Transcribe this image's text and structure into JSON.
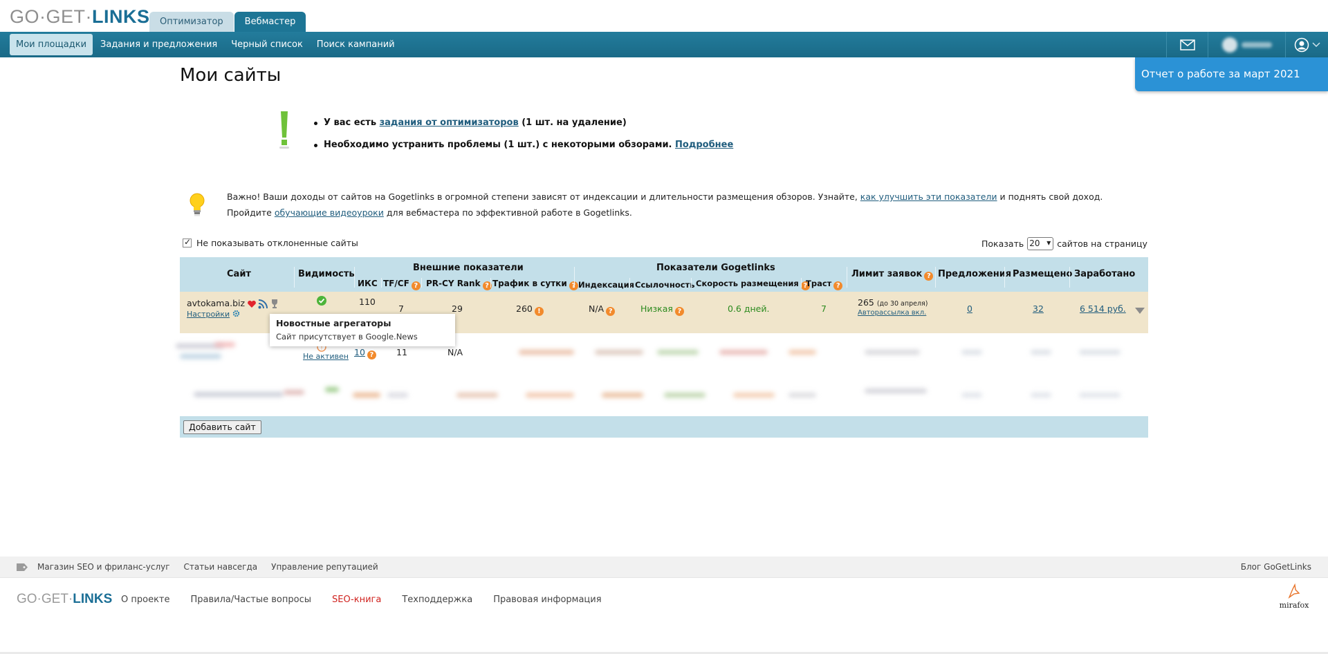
{
  "header": {
    "logo_part1": "GO·GET·",
    "logo_part2": "LINKS",
    "tabs": [
      {
        "label": "Оптимизатор"
      },
      {
        "label": "Вебмастер"
      }
    ],
    "nav": [
      {
        "label": "Мои площадки"
      },
      {
        "label": "Задания и предложения"
      },
      {
        "label": "Черный список"
      },
      {
        "label": "Поиск кампаний"
      }
    ],
    "icons": [
      "envelope-icon",
      "user-icon",
      "chevron-down-icon"
    ]
  },
  "report_banner": "Отчет о работе за март 2021",
  "page_title": "Мои сайты",
  "alerts": {
    "line1_prefix": "У вас есть ",
    "line1_link": "задания от оптимизаторов",
    "line1_suffix": " (1 шт. на удаление)",
    "line2_text": "Необходимо устранить проблемы (1 шт.) с некоторыми обзорами. ",
    "line2_link": "Подробнее"
  },
  "tip": {
    "t1": "Важно! Ваши доходы от сайтов на Gogetlinks в огромной степени зависят от индексации и длительности размещения обзоров. Узнайте, ",
    "link1": "как улучшить эти показатели",
    "t2": " и поднять свой доход. Пройдите ",
    "link2": "обучающие видеоуроки",
    "t3": " для вебмастера по эффективной работе в Gogetlinks."
  },
  "filter": {
    "hide_rejected_label": "Не показывать отклоненные сайты",
    "hide_rejected_checked": true,
    "show_label": "Показать",
    "per_page": "20",
    "per_page_suffix": "сайтов на страницу"
  },
  "table": {
    "headers": {
      "site": "Сайт",
      "visibility": "Видимость",
      "external_group": "Внешние показатели",
      "iks": "ИКС",
      "tfcf": "TF/CF",
      "prcy": "PR-CY Rank",
      "traffic": "Трафик в сутки",
      "ggl_group": "Показатели Gogetlinks",
      "indexing": "Индексация",
      "linkage": "Ссылочность",
      "speed": "Скорость размещения",
      "trust": "Траст",
      "limit": "Лимит заявок",
      "offers": "Предложения",
      "placed": "Размещено",
      "earned": "Заработано"
    },
    "row1": {
      "site": "avtokama.biz",
      "settings": "Настройки",
      "iks": "110",
      "tfcf": "7",
      "prcy": "29",
      "traffic": "260",
      "indexing": "N/A",
      "linkage": "Низкая",
      "speed": "0.6 дней.",
      "trust": "7",
      "limit": "265",
      "limit_note": "(до 30 апреля)",
      "autosend": "Авторассылка вкл.",
      "offers": "0",
      "placed": "32",
      "earned": "6 514 руб."
    },
    "row2": {
      "status": "Не активен",
      "iks": "10",
      "tfcf": "11",
      "prcy": "N/A"
    },
    "add_button": "Добавить сайт"
  },
  "tooltip": {
    "title": "Новостные агрегаторы",
    "text": "Сайт присутствует в Google.News"
  },
  "footer": {
    "top_links": [
      "Магазин SEO и фриланс-услуг",
      "Статьи навсегда",
      "Управление репутацией"
    ],
    "blog": "Блог GoGetLinks",
    "logo_part1": "GO·GET·",
    "logo_part2": "LINKS",
    "links": [
      "О проекте",
      "Правила/Частые вопросы",
      "SEO-книга",
      "Техподдержка",
      "Правовая информация"
    ],
    "mirafox": "mirafox"
  }
}
